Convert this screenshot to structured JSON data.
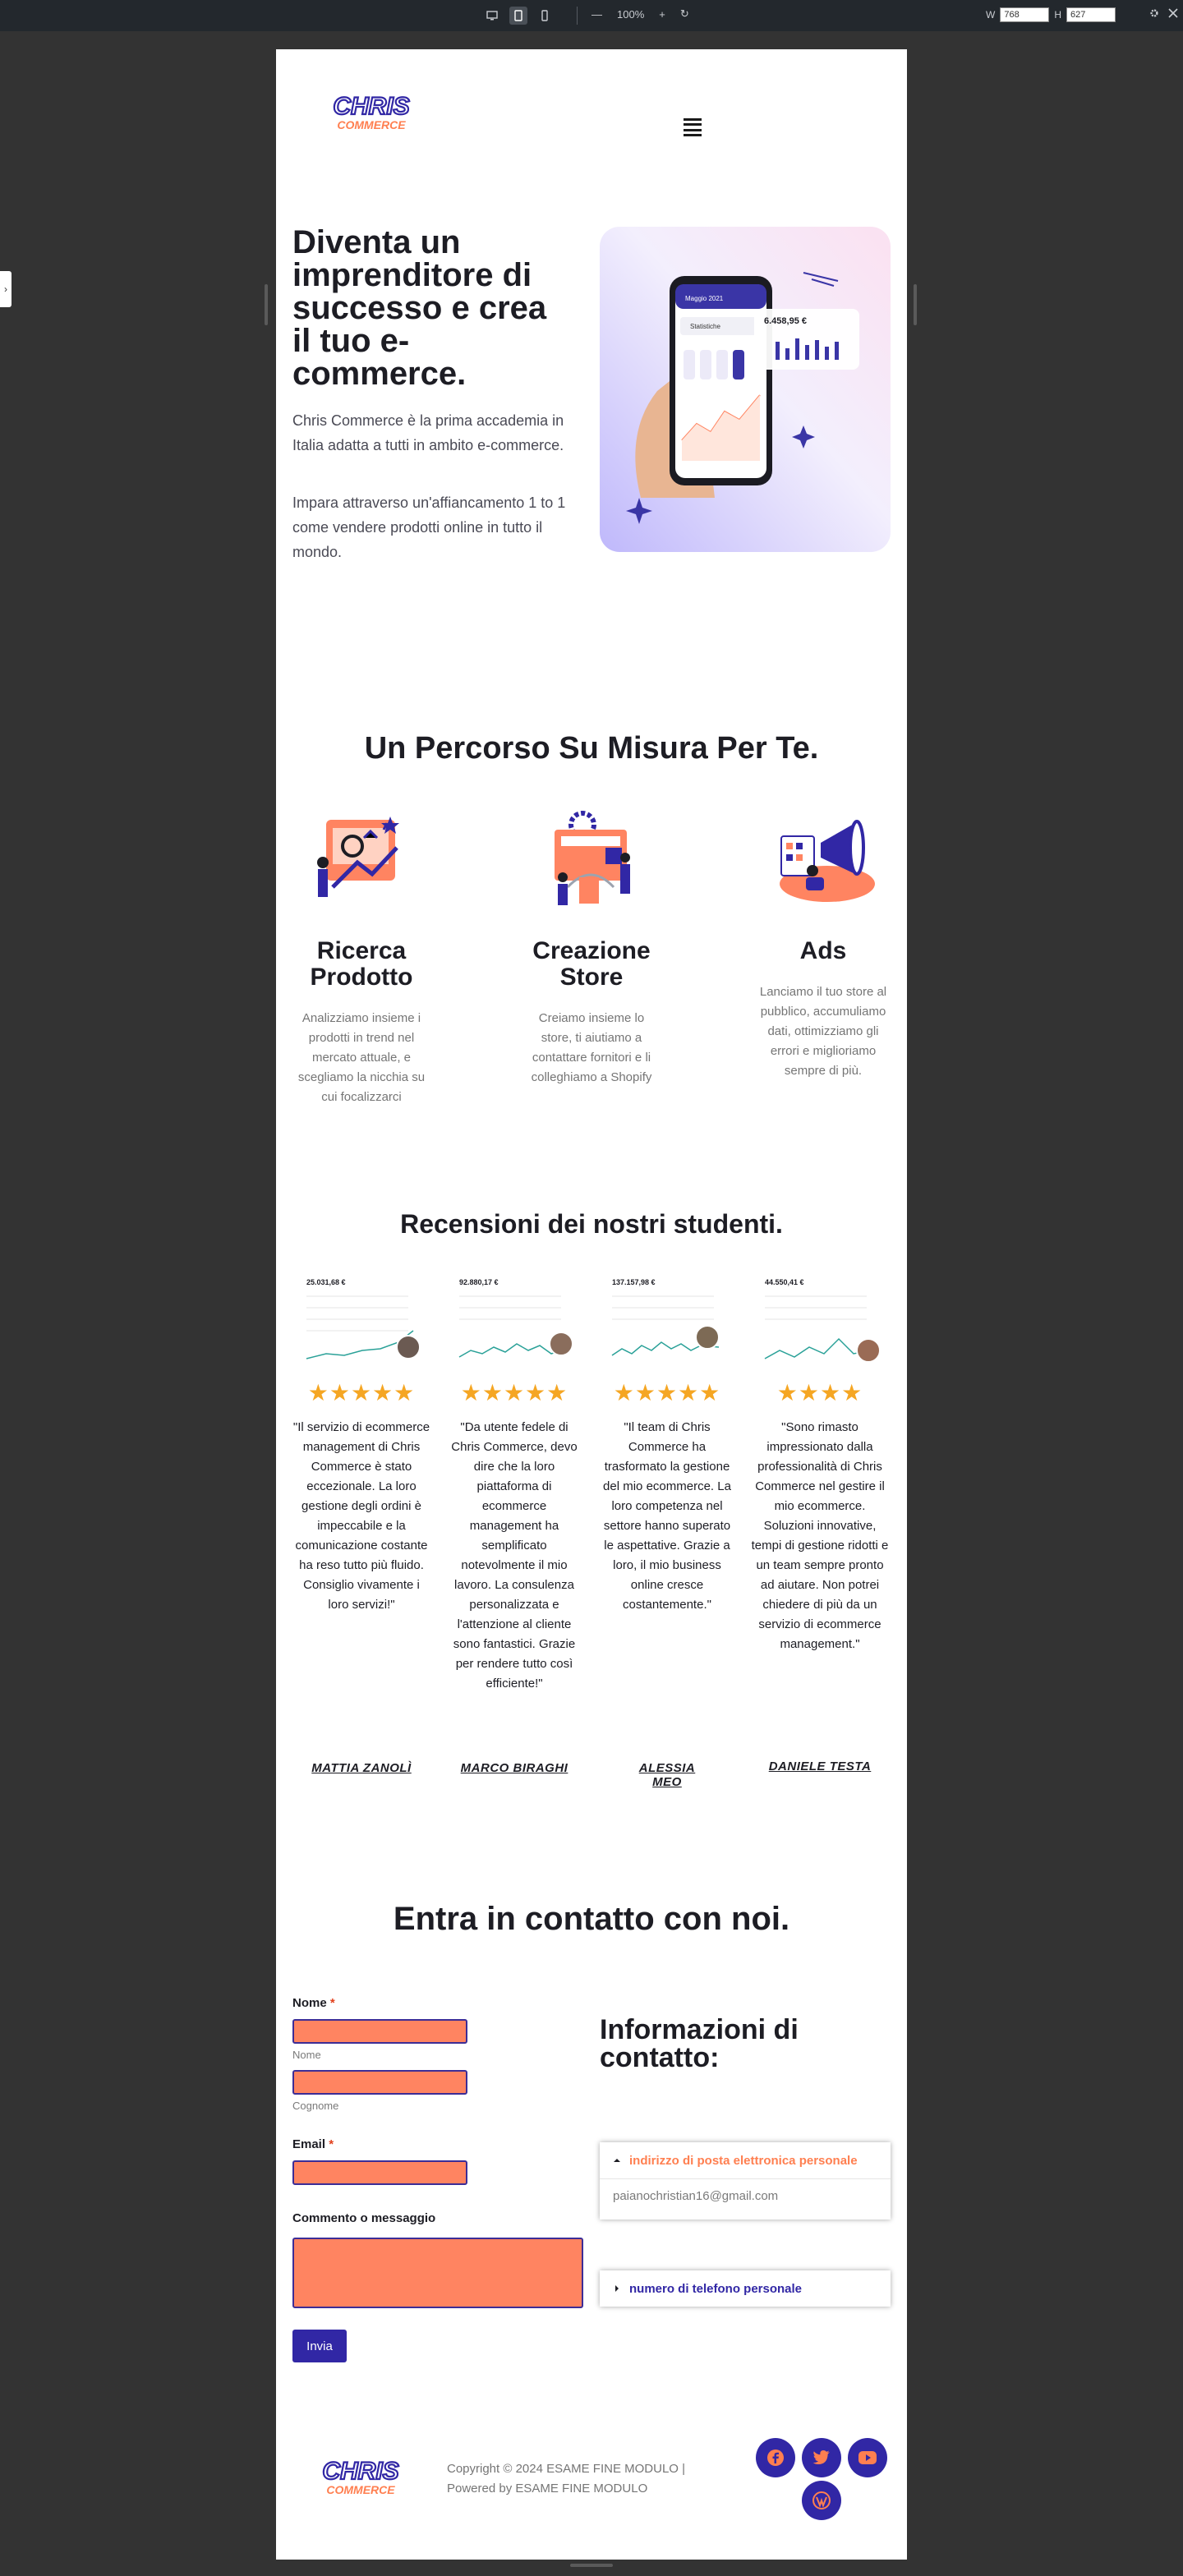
{
  "toolbar": {
    "zoom": "100%",
    "width_label": "W",
    "width_value": "768",
    "height_label": "H",
    "height_value": "627"
  },
  "header": {
    "logo_line1": "CHRIS",
    "logo_line2": "COMMERCE"
  },
  "hero": {
    "title": "Diventa un imprenditore di successo e crea il tuo e-commerce.",
    "p1": "Chris Commerce è la prima accademia in Italia adatta a tutti in ambito e-commerce.",
    "p2": "Impara attraverso un'affiancamento 1 to 1 come vendere prodotti online in tutto il mondo.",
    "phone": {
      "month": "Maggio 2021",
      "amount": "6.458,95 €",
      "label": "Statistiche"
    }
  },
  "services": {
    "title": "Un Percorso Su Misura Per Te.",
    "items": [
      {
        "title": "Ricerca Prodotto",
        "text": "Analizziamo insieme i prodotti in trend nel mercato attuale, e scegliamo la nicchia su cui focalizzarci"
      },
      {
        "title": "Creazione Store",
        "text": "Creiamo insieme lo store, ti aiutiamo a contattare fornitori e li colleghiamo a Shopify"
      },
      {
        "title": "Ads",
        "text": "Lanciamo il tuo store al pubblico, accumuliamo dati, ottimizziamo gli errori e miglioriamo sempre di più."
      }
    ]
  },
  "reviews": {
    "title": "Recensioni dei nostri studenti.",
    "items": [
      {
        "amount": "25.031,68 €",
        "stars": "★★★★★",
        "text": "\"Il servizio di ecommerce management di Chris Commerce è stato eccezionale. La loro gestione degli ordini è impeccabile e la comunicazione costante ha reso tutto più fluido. Consiglio vivamente i loro servizi!\"",
        "name": "MATTIA ZANOLÌ"
      },
      {
        "amount": "92.880,17 €",
        "stars": "★★★★★",
        "text": "\"Da utente fedele di Chris Commerce, devo dire che la loro piattaforma di ecommerce management ha semplificato notevolmente il mio lavoro. La consulenza personalizzata e l'attenzione al cliente sono fantastici. Grazie per rendere tutto così efficiente!\"",
        "name": "MARCO BIRAGHI"
      },
      {
        "amount": "137.157,98 €",
        "stars": "★★★★★",
        "text": "\"Il team di Chris Commerce ha trasformato la gestione del mio ecommerce. La loro competenza nel settore  hanno superato le aspettative. Grazie a loro, il mio business online cresce costantemente.\"",
        "name": "ALESSIA MEO"
      },
      {
        "amount": "44.550,41 €",
        "stars": "★★★★",
        "text": "\"Sono rimasto impressionato dalla professionalità di Chris Commerce nel gestire il mio ecommerce. Soluzioni innovative, tempi di gestione ridotti e un team sempre pronto ad aiutare. Non potrei chiedere di più da un servizio di ecommerce management.\"",
        "name": "DANIELE TESTA"
      }
    ]
  },
  "contact": {
    "title": "Entra in contatto con noi.",
    "name_label": "Nome",
    "required_mark": "*",
    "first_sub": "Nome",
    "last_sub": "Cognome",
    "email_label": "Email",
    "comment_label": "Commento o messaggio",
    "send_label": "Invia",
    "info_title": "Informazioni di contatto:",
    "accordion": [
      {
        "label": "indirizzo di posta elettronica personale",
        "value": "paianochristian16@gmail.com",
        "expanded": true,
        "color": "#ff7f50"
      },
      {
        "label": "numero di telefono personale",
        "expanded": false,
        "color": "#3127a5"
      }
    ]
  },
  "footer": {
    "copyright": "Copyright © 2024 ESAME FINE MODULO | Powered by ESAME FINE MODULO",
    "social": [
      "facebook-icon",
      "twitter-icon",
      "youtube-icon",
      "wordpress-icon"
    ]
  },
  "colors": {
    "brand_blue": "#3127a5",
    "brand_orange": "#ff8461",
    "star": "#f5a623",
    "heading": "#1d1d24"
  }
}
